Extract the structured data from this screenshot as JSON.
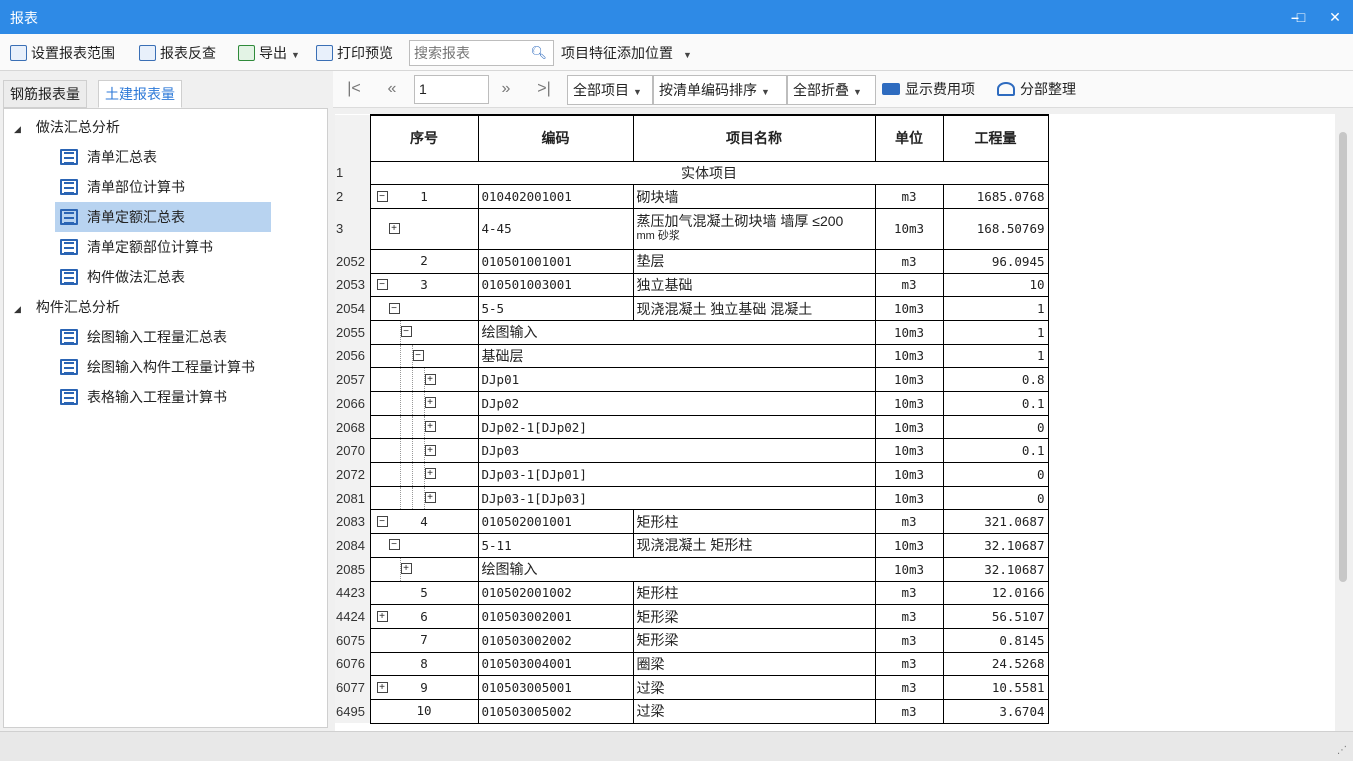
{
  "window": {
    "title": "报表"
  },
  "toolbar": {
    "set_range": "设置报表范围",
    "report_check": "报表反查",
    "export": "导出",
    "print_preview": "打印预览",
    "search_placeholder": "搜索报表",
    "feature_position": "项目特征添加位置"
  },
  "tabs": [
    {
      "label": "钢筋报表量",
      "active": false
    },
    {
      "label": "土建报表量",
      "active": true
    }
  ],
  "tree": {
    "groups": [
      {
        "label": "做法汇总分析",
        "items": [
          "清单汇总表",
          "清单部位计算书",
          "清单定额汇总表",
          "清单定额部位计算书",
          "构件做法汇总表"
        ]
      },
      {
        "label": "构件汇总分析",
        "items": [
          "绘图输入工程量汇总表",
          "绘图输入构件工程量计算书",
          "表格输入工程量计算书"
        ]
      }
    ],
    "selected": "清单定额汇总表"
  },
  "report_toolbar": {
    "page": "1",
    "scope": "全部项目",
    "sort": "按清单编码排序",
    "fold": "全部折叠",
    "show_fee": "显示费用项",
    "section_arrange": "分部整理"
  },
  "table": {
    "headers": [
      "序号",
      "编码",
      "项目名称",
      "单位",
      "工程量"
    ],
    "section_title": "实体项目",
    "rows": [
      {
        "rn": "2",
        "level": 0,
        "box": "minus",
        "seq": "1",
        "code": "010402001001",
        "name": "砌块墙",
        "unit": "m3",
        "qty": "1685.0768"
      },
      {
        "rn": "3",
        "level": 1,
        "box": "plus",
        "seq": "",
        "code": "4-45",
        "name": "蒸压加气混凝土砌块墙 墙厚 ≤200",
        "name2": "mm 砂浆",
        "unit": "10m3",
        "qty": "168.50769"
      },
      {
        "rn": "2052",
        "level": 0,
        "box": "",
        "seq": "2",
        "code": "010501001001",
        "name": "垫层",
        "unit": "m3",
        "qty": "96.0945"
      },
      {
        "rn": "2053",
        "level": 0,
        "box": "minus",
        "seq": "3",
        "code": "010501003001",
        "name": "独立基础",
        "unit": "m3",
        "qty": "10"
      },
      {
        "rn": "2054",
        "level": 1,
        "box": "minus",
        "seq": "",
        "code": "5-5",
        "name": "现浇混凝土 独立基础 混凝土",
        "unit": "10m3",
        "qty": "1"
      },
      {
        "rn": "2055",
        "level": 2,
        "box": "minus",
        "seq": "",
        "code": "绘图输入",
        "name": "",
        "unit": "10m3",
        "qty": "1"
      },
      {
        "rn": "2056",
        "level": 3,
        "box": "minus",
        "seq": "",
        "code": "基础层",
        "name": "",
        "unit": "10m3",
        "qty": "1"
      },
      {
        "rn": "2057",
        "level": 4,
        "box": "plus",
        "seq": "",
        "code": "DJp01",
        "name": "",
        "unit": "10m3",
        "qty": "0.8"
      },
      {
        "rn": "2066",
        "level": 4,
        "box": "plus",
        "seq": "",
        "code": "DJp02",
        "name": "",
        "unit": "10m3",
        "qty": "0.1"
      },
      {
        "rn": "2068",
        "level": 4,
        "box": "plus",
        "seq": "",
        "code": "DJp02-1[DJp02]",
        "name": "",
        "unit": "10m3",
        "qty": "0"
      },
      {
        "rn": "2070",
        "level": 4,
        "box": "plus",
        "seq": "",
        "code": "DJp03",
        "name": "",
        "unit": "10m3",
        "qty": "0.1"
      },
      {
        "rn": "2072",
        "level": 4,
        "box": "plus",
        "seq": "",
        "code": "DJp03-1[DJp01]",
        "name": "",
        "unit": "10m3",
        "qty": "0"
      },
      {
        "rn": "2081",
        "level": 4,
        "box": "plus",
        "seq": "",
        "code": "DJp03-1[DJp03]",
        "name": "",
        "unit": "10m3",
        "qty": "0"
      },
      {
        "rn": "2083",
        "level": 0,
        "box": "minus",
        "seq": "4",
        "code": "010502001001",
        "name": "矩形柱",
        "unit": "m3",
        "qty": "321.0687"
      },
      {
        "rn": "2084",
        "level": 1,
        "box": "minus",
        "seq": "",
        "code": "5-11",
        "name": "现浇混凝土 矩形柱",
        "unit": "10m3",
        "qty": "32.10687"
      },
      {
        "rn": "2085",
        "level": 2,
        "box": "plus",
        "seq": "",
        "code": "绘图输入",
        "name": "",
        "unit": "10m3",
        "qty": "32.10687"
      },
      {
        "rn": "4423",
        "level": 0,
        "box": "",
        "seq": "5",
        "code": "010502001002",
        "name": "矩形柱",
        "unit": "m3",
        "qty": "12.0166"
      },
      {
        "rn": "4424",
        "level": 0,
        "box": "plus",
        "seq": "6",
        "code": "010503002001",
        "name": "矩形梁",
        "unit": "m3",
        "qty": "56.5107"
      },
      {
        "rn": "6075",
        "level": 0,
        "box": "",
        "seq": "7",
        "code": "010503002002",
        "name": "矩形梁",
        "unit": "m3",
        "qty": "0.8145"
      },
      {
        "rn": "6076",
        "level": 0,
        "box": "",
        "seq": "8",
        "code": "010503004001",
        "name": "圈梁",
        "unit": "m3",
        "qty": "24.5268"
      },
      {
        "rn": "6077",
        "level": 0,
        "box": "plus",
        "seq": "9",
        "code": "010503005001",
        "name": "过梁",
        "unit": "m3",
        "qty": "10.5581"
      },
      {
        "rn": "6495",
        "level": 0,
        "box": "",
        "seq": "10",
        "code": "010503005002",
        "name": "过梁",
        "unit": "m3",
        "qty": "3.6704"
      }
    ]
  }
}
